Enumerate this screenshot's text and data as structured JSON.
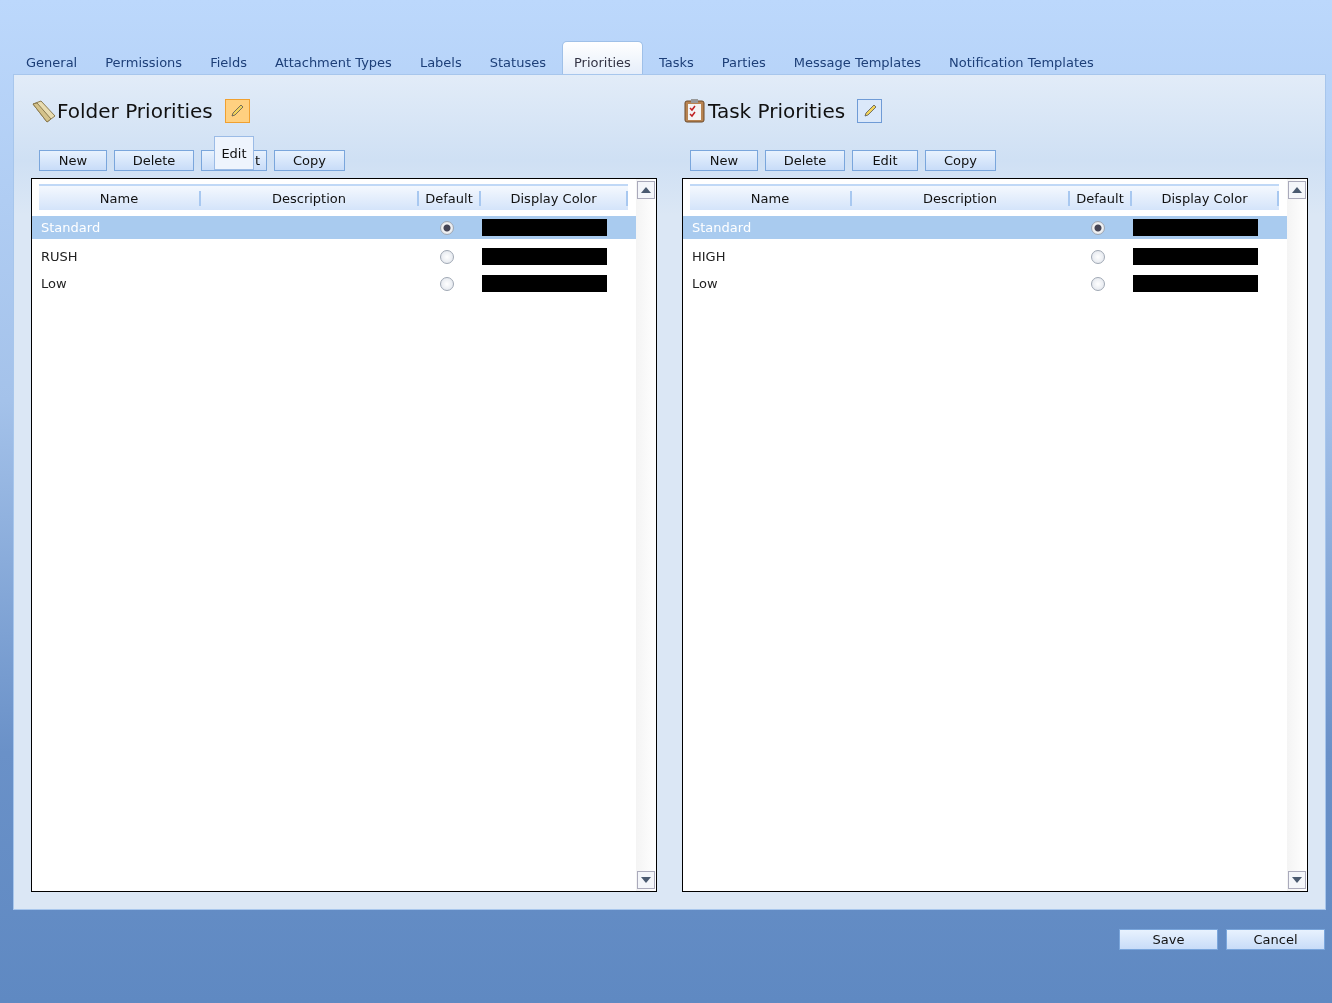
{
  "tabs": [
    {
      "label": "General",
      "selected": false
    },
    {
      "label": "Permissions",
      "selected": false
    },
    {
      "label": "Fields",
      "selected": false
    },
    {
      "label": "Attachment Types",
      "selected": false
    },
    {
      "label": "Labels",
      "selected": false
    },
    {
      "label": "Statuses",
      "selected": false
    },
    {
      "label": "Priorities",
      "selected": true
    },
    {
      "label": "Tasks",
      "selected": false
    },
    {
      "label": "Parties",
      "selected": false
    },
    {
      "label": "Message Templates",
      "selected": false
    },
    {
      "label": "Notification Templates",
      "selected": false
    }
  ],
  "sections": [
    {
      "kind": "folder",
      "title": "Folder Priorities",
      "edit_hovered": true,
      "buttons": [
        "New",
        "Delete",
        "t",
        "Copy"
      ],
      "tooltip": "Edit",
      "columns": [
        "Name",
        "Description",
        "Default",
        "Display Color"
      ],
      "rows": [
        {
          "name": "Standard",
          "selected": true,
          "default": true,
          "color": "#000000"
        },
        {
          "name": "RUSH",
          "selected": false,
          "default": false,
          "color": "#000000"
        },
        {
          "name": "Low",
          "selected": false,
          "default": false,
          "color": "#000000"
        }
      ]
    },
    {
      "kind": "task",
      "title": "Task Priorities",
      "edit_hovered": false,
      "buttons": [
        "New",
        "Delete",
        "Edit",
        "Copy"
      ],
      "columns": [
        "Name",
        "Description",
        "Default",
        "Display Color"
      ],
      "rows": [
        {
          "name": "Standard",
          "selected": true,
          "default": true,
          "color": "#000000"
        },
        {
          "name": "HIGH",
          "selected": false,
          "default": false,
          "color": "#000000"
        },
        {
          "name": "Low",
          "selected": false,
          "default": false,
          "color": "#000000"
        }
      ]
    }
  ],
  "footer_buttons": [
    "Save",
    "Cancel"
  ]
}
